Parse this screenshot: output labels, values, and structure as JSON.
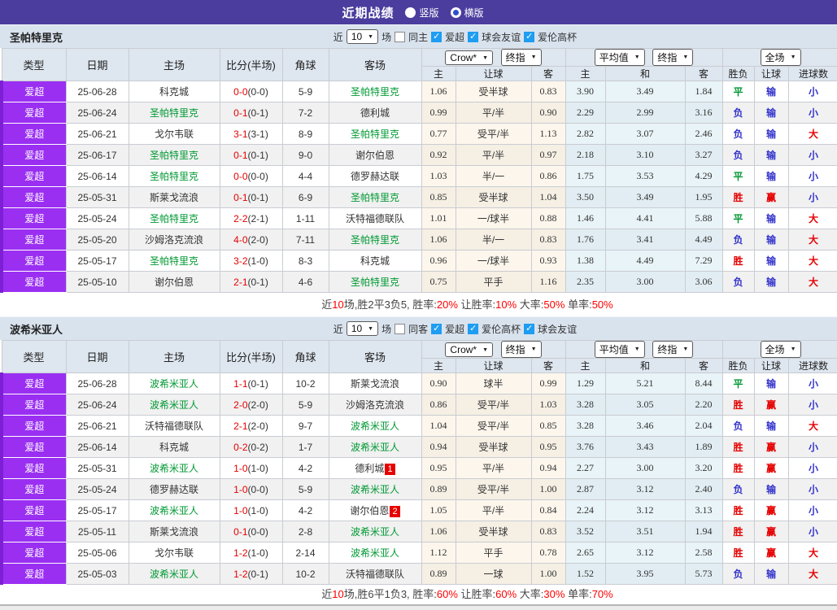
{
  "topbar": {
    "title": "近期战绩",
    "radios": [
      {
        "label": "竖版",
        "selected": true
      },
      {
        "label": "横版",
        "selected": false
      }
    ]
  },
  "columns": {
    "type": "类型",
    "date": "日期",
    "home": "主场",
    "score": "比分(半场)",
    "corner": "角球",
    "away": "客场",
    "odds_company": "Crow*",
    "final1": "终指",
    "average": "平均值",
    "final2": "终指",
    "fullmatch": "全场",
    "sub": [
      "主",
      "让球",
      "客",
      "主",
      "和",
      "客",
      "胜负",
      "让球",
      "进球数"
    ]
  },
  "colors": {
    "topbar_purple": "#4b3d9e",
    "league_purple": "#9a2ff2",
    "focal_team_green": "#009933",
    "win_red": "#e60000",
    "lose_blue": "#3333cc",
    "odds_col_bg": "#fdf6ec",
    "avg_col_bg": "#e9f4f8",
    "checkbox_blue": "#1e9df2"
  },
  "sections": [
    {
      "team": "圣帕特里克",
      "filter": {
        "near": "近",
        "count": "10",
        "games": "场",
        "same": "同主",
        "same_checked": false,
        "leagues": [
          "爱超",
          "球会友谊",
          "爱伦高杯"
        ],
        "leagues_checked": [
          true,
          true,
          true
        ]
      },
      "rows": [
        {
          "type": "爱超",
          "date": "25-06-28",
          "home": "科克城",
          "score": "0-0",
          "half": "0-0",
          "corner": "5-9",
          "away": "圣帕特里克",
          "odds": [
            "1.06",
            "受半球",
            "0.83"
          ],
          "avg": [
            "3.90",
            "3.49",
            "1.84"
          ],
          "result": [
            "平",
            "输",
            "小"
          ]
        },
        {
          "type": "爱超",
          "date": "25-06-24",
          "home": "圣帕特里克",
          "score": "0-1",
          "half": "0-1",
          "corner": "7-2",
          "away": "德利城",
          "odds": [
            "0.99",
            "平/半",
            "0.90"
          ],
          "avg": [
            "2.29",
            "2.99",
            "3.16"
          ],
          "result": [
            "负",
            "输",
            "小"
          ]
        },
        {
          "type": "爱超",
          "date": "25-06-21",
          "home": "戈尔韦联",
          "score": "3-1",
          "half": "3-1",
          "corner": "8-9",
          "away": "圣帕特里克",
          "odds": [
            "0.77",
            "受平/半",
            "1.13"
          ],
          "avg": [
            "2.82",
            "3.07",
            "2.46"
          ],
          "result": [
            "负",
            "输",
            "大"
          ]
        },
        {
          "type": "爱超",
          "date": "25-06-17",
          "home": "圣帕特里克",
          "score": "0-1",
          "half": "0-1",
          "corner": "9-0",
          "away": "谢尔伯恩",
          "odds": [
            "0.92",
            "平/半",
            "0.97"
          ],
          "avg": [
            "2.18",
            "3.10",
            "3.27"
          ],
          "result": [
            "负",
            "输",
            "小"
          ]
        },
        {
          "type": "爱超",
          "date": "25-06-14",
          "home": "圣帕特里克",
          "score": "0-0",
          "half": "0-0",
          "corner": "4-4",
          "away": "德罗赫达联",
          "odds": [
            "1.03",
            "半/一",
            "0.86"
          ],
          "avg": [
            "1.75",
            "3.53",
            "4.29"
          ],
          "result": [
            "平",
            "输",
            "小"
          ]
        },
        {
          "type": "爱超",
          "date": "25-05-31",
          "home": "斯莱戈流浪",
          "score": "0-1",
          "half": "0-1",
          "corner": "6-9",
          "away": "圣帕特里克",
          "odds": [
            "0.85",
            "受半球",
            "1.04"
          ],
          "avg": [
            "3.50",
            "3.49",
            "1.95"
          ],
          "result": [
            "胜",
            "赢",
            "小"
          ]
        },
        {
          "type": "爱超",
          "date": "25-05-24",
          "home": "圣帕特里克",
          "score": "2-2",
          "half": "2-1",
          "corner": "1-11",
          "away": "沃特福德联队",
          "odds": [
            "1.01",
            "一/球半",
            "0.88"
          ],
          "avg": [
            "1.46",
            "4.41",
            "5.88"
          ],
          "result": [
            "平",
            "输",
            "大"
          ]
        },
        {
          "type": "爱超",
          "date": "25-05-20",
          "home": "沙姆洛克流浪",
          "score": "4-0",
          "half": "2-0",
          "corner": "7-11",
          "away": "圣帕特里克",
          "odds": [
            "1.06",
            "半/一",
            "0.83"
          ],
          "avg": [
            "1.76",
            "3.41",
            "4.49"
          ],
          "result": [
            "负",
            "输",
            "大"
          ]
        },
        {
          "type": "爱超",
          "date": "25-05-17",
          "home": "圣帕特里克",
          "score": "3-2",
          "half": "1-0",
          "corner": "8-3",
          "away": "科克城",
          "odds": [
            "0.96",
            "一/球半",
            "0.93"
          ],
          "avg": [
            "1.38",
            "4.49",
            "7.29"
          ],
          "result": [
            "胜",
            "输",
            "大"
          ]
        },
        {
          "type": "爱超",
          "date": "25-05-10",
          "home": "谢尔伯恩",
          "score": "2-1",
          "half": "0-1",
          "corner": "4-6",
          "away": "圣帕特里克",
          "odds": [
            "0.75",
            "平手",
            "1.16"
          ],
          "avg": [
            "2.35",
            "3.00",
            "3.06"
          ],
          "result": [
            "负",
            "输",
            "大"
          ]
        }
      ],
      "summary": [
        {
          "t": "近"
        },
        {
          "t": "10",
          "red": true
        },
        {
          "t": "场,胜2平3负5, 胜率:"
        },
        {
          "t": "20%",
          "red": true
        },
        {
          "t": " 让胜率:"
        },
        {
          "t": "10%",
          "red": true
        },
        {
          "t": " 大率:"
        },
        {
          "t": "50%",
          "red": true
        },
        {
          "t": " 单率:"
        },
        {
          "t": "50%",
          "red": true
        }
      ]
    },
    {
      "team": "波希米亚人",
      "filter": {
        "near": "近",
        "count": "10",
        "games": "场",
        "same": "同客",
        "same_checked": false,
        "leagues": [
          "爱超",
          "爱伦高杯",
          "球会友谊"
        ],
        "leagues_checked": [
          true,
          true,
          true
        ]
      },
      "rows": [
        {
          "type": "爱超",
          "date": "25-06-28",
          "home": "波希米亚人",
          "score": "1-1",
          "half": "0-1",
          "corner": "10-2",
          "away": "斯莱戈流浪",
          "odds": [
            "0.90",
            "球半",
            "0.99"
          ],
          "avg": [
            "1.29",
            "5.21",
            "8.44"
          ],
          "result": [
            "平",
            "输",
            "小"
          ]
        },
        {
          "type": "爱超",
          "date": "25-06-24",
          "home": "波希米亚人",
          "score": "2-0",
          "half": "2-0",
          "corner": "5-9",
          "away": "沙姆洛克流浪",
          "odds": [
            "0.86",
            "受平/半",
            "1.03"
          ],
          "avg": [
            "3.28",
            "3.05",
            "2.20"
          ],
          "result": [
            "胜",
            "赢",
            "小"
          ]
        },
        {
          "type": "爱超",
          "date": "25-06-21",
          "home": "沃特福德联队",
          "score": "2-1",
          "half": "2-0",
          "corner": "9-7",
          "away": "波希米亚人",
          "odds": [
            "1.04",
            "受平/半",
            "0.85"
          ],
          "avg": [
            "3.28",
            "3.46",
            "2.04"
          ],
          "result": [
            "负",
            "输",
            "大"
          ]
        },
        {
          "type": "爱超",
          "date": "25-06-14",
          "home": "科克城",
          "score": "0-2",
          "half": "0-2",
          "corner": "1-7",
          "away": "波希米亚人",
          "odds": [
            "0.94",
            "受半球",
            "0.95"
          ],
          "avg": [
            "3.76",
            "3.43",
            "1.89"
          ],
          "result": [
            "胜",
            "赢",
            "小"
          ]
        },
        {
          "type": "爱超",
          "date": "25-05-31",
          "home": "波希米亚人",
          "score": "1-0",
          "half": "1-0",
          "corner": "4-2",
          "away": "德利城",
          "away_badge": "1",
          "odds": [
            "0.95",
            "平/半",
            "0.94"
          ],
          "avg": [
            "2.27",
            "3.00",
            "3.20"
          ],
          "result": [
            "胜",
            "赢",
            "小"
          ]
        },
        {
          "type": "爱超",
          "date": "25-05-24",
          "home": "德罗赫达联",
          "score": "1-0",
          "half": "0-0",
          "corner": "5-9",
          "away": "波希米亚人",
          "odds": [
            "0.89",
            "受平/半",
            "1.00"
          ],
          "avg": [
            "2.87",
            "3.12",
            "2.40"
          ],
          "result": [
            "负",
            "输",
            "小"
          ]
        },
        {
          "type": "爱超",
          "date": "25-05-17",
          "home": "波希米亚人",
          "score": "1-0",
          "half": "1-0",
          "corner": "4-2",
          "away": "谢尔伯恩",
          "away_badge": "2",
          "odds": [
            "1.05",
            "平/半",
            "0.84"
          ],
          "avg": [
            "2.24",
            "3.12",
            "3.13"
          ],
          "result": [
            "胜",
            "赢",
            "小"
          ]
        },
        {
          "type": "爱超",
          "date": "25-05-11",
          "home": "斯莱戈流浪",
          "score": "0-1",
          "half": "0-0",
          "corner": "2-8",
          "away": "波希米亚人",
          "odds": [
            "1.06",
            "受半球",
            "0.83"
          ],
          "avg": [
            "3.52",
            "3.51",
            "1.94"
          ],
          "result": [
            "胜",
            "赢",
            "小"
          ]
        },
        {
          "type": "爱超",
          "date": "25-05-06",
          "home": "戈尔韦联",
          "score": "1-2",
          "half": "1-0",
          "corner": "2-14",
          "away": "波希米亚人",
          "odds": [
            "1.12",
            "平手",
            "0.78"
          ],
          "avg": [
            "2.65",
            "3.12",
            "2.58"
          ],
          "result": [
            "胜",
            "赢",
            "大"
          ]
        },
        {
          "type": "爱超",
          "date": "25-05-03",
          "home": "波希米亚人",
          "score": "1-2",
          "half": "0-1",
          "corner": "10-2",
          "away": "沃特福德联队",
          "odds": [
            "0.89",
            "一球",
            "1.00"
          ],
          "avg": [
            "1.52",
            "3.95",
            "5.73"
          ],
          "result": [
            "负",
            "输",
            "大"
          ]
        }
      ],
      "summary": [
        {
          "t": "近"
        },
        {
          "t": "10",
          "red": true
        },
        {
          "t": "场,胜6平1负3, 胜率:"
        },
        {
          "t": "60%",
          "red": true
        },
        {
          "t": " 让胜率:"
        },
        {
          "t": "60%",
          "red": true
        },
        {
          "t": " 大率:"
        },
        {
          "t": "30%",
          "red": true
        },
        {
          "t": " 单率:"
        },
        {
          "t": "70%",
          "red": true
        }
      ]
    }
  ]
}
